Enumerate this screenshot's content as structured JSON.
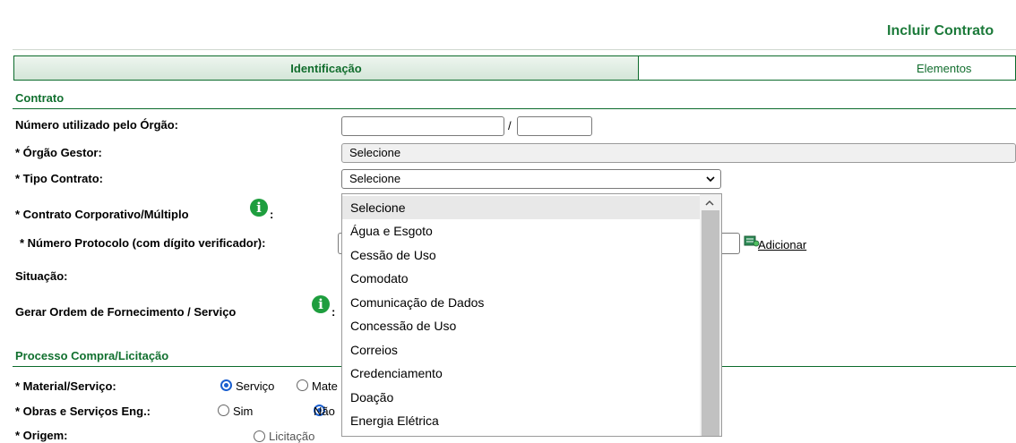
{
  "page_title": "Incluir Contrato",
  "tabs": [
    {
      "label": "Identificação",
      "active": true
    },
    {
      "label": "Elementos",
      "active": false
    }
  ],
  "section_contrato": {
    "title": "Contrato",
    "fields": {
      "numero_orgao": {
        "label": "Número utilizado pelo Órgão:",
        "separator": "/",
        "value1": "",
        "value2": ""
      },
      "orgao_gestor": {
        "label": "* Órgão Gestor:",
        "value": "Selecione"
      },
      "tipo_contrato": {
        "label": "* Tipo Contrato:",
        "value": "Selecione"
      },
      "contrato_corporativo": {
        "label": "* Contrato Corporativo/Múltiplo",
        "suffix": ":"
      },
      "numero_protocolo": {
        "label": "* Número Protocolo (com dígito verificador):",
        "add_label": " Adicionar"
      },
      "situacao": {
        "label": "Situação:"
      },
      "gerar_ordem": {
        "label": "Gerar Ordem de Fornecimento / Serviço",
        "suffix": ":"
      }
    }
  },
  "dropdown": {
    "options": [
      "Selecione",
      "Água e Esgoto",
      "Cessão de Uso",
      "Comodato",
      "Comunicação de Dados",
      "Concessão de Uso",
      "Correios",
      "Credenciamento",
      "Doação",
      "Energia Elétrica"
    ],
    "selected_index": 0
  },
  "section_processo": {
    "title": "Processo Compra/Licitação",
    "material_servico": {
      "label": "* Material/Serviço:",
      "options": [
        "Serviço",
        "Mate"
      ],
      "selected": 0
    },
    "obras_servicos": {
      "label": "* Obras e Serviços Eng.:",
      "options": [
        "Sim",
        "Não"
      ],
      "selected": 1
    },
    "origem": {
      "label": "* Origem:",
      "options": [
        "Licitação"
      ]
    }
  },
  "icons": {
    "info": "info-icon",
    "add": "add-document-icon",
    "chevron": "chevron-down-icon",
    "scroll_up": "scroll-up-arrow-icon"
  },
  "colors": {
    "brand_green": "#1c7a3a",
    "info_green": "#1e9e3e",
    "radio_blue": "#1a5fcf"
  }
}
